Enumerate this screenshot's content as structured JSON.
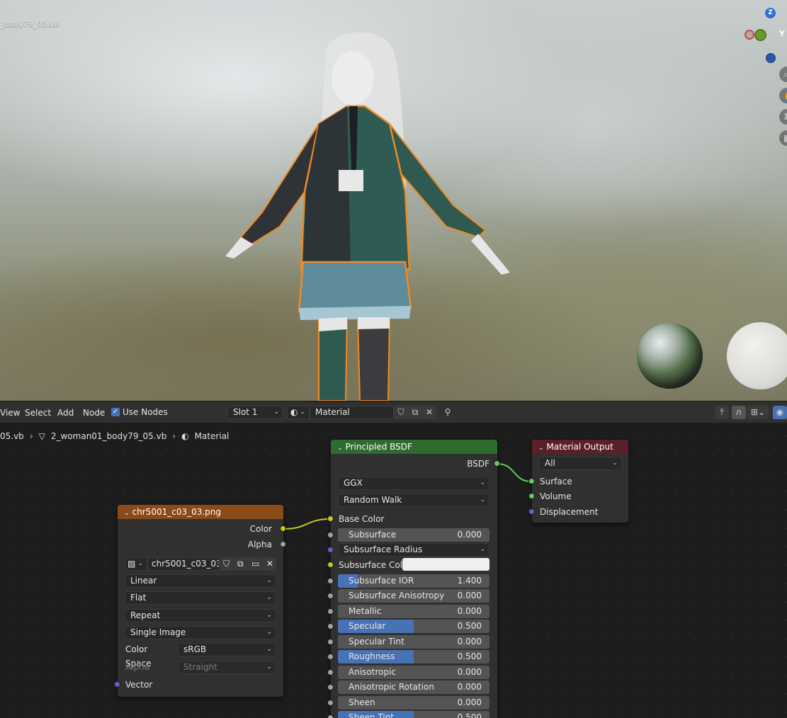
{
  "viewport": {
    "file_label": "_body79_05.vb",
    "gizmo": {
      "z": "Z",
      "y": "Y"
    }
  },
  "node_header": {
    "menus": [
      "View",
      "Select",
      "Add",
      "Node"
    ],
    "use_nodes_label": "Use Nodes",
    "use_nodes_checked": true,
    "slot": "Slot 1",
    "material_name": "Material"
  },
  "breadcrumb": {
    "object": "05.vb",
    "mesh": "2_woman01_body79_05.vb",
    "material": "Material"
  },
  "image_node": {
    "title": "chr5001_c03_03.png",
    "title_color": "#8b4a17",
    "outputs": {
      "color": "Color",
      "alpha": "Alpha"
    },
    "image_name": "chr5001_c03_03.p...",
    "interpolation": "Linear",
    "projection": "Flat",
    "extension": "Repeat",
    "source": "Single Image",
    "color_space_label": "Color Space",
    "color_space": "sRGB",
    "alpha_label": "Alpha",
    "alpha_mode": "Straight",
    "vector_label": "Vector"
  },
  "bsdf_node": {
    "title": "Principled BSDF",
    "title_color": "#2e6b2e",
    "output_label": "BSDF",
    "distribution": "GGX",
    "subsurface_method": "Random Walk",
    "base_color_label": "Base Color",
    "subsurface_radius_label": "Subsurface Radius",
    "subsurface_color_label": "Subsurface Color",
    "sliders": [
      {
        "label": "Subsurface",
        "value": "0.000",
        "fraction": 0.0
      },
      {
        "label": "Subsurface IOR",
        "value": "1.400",
        "fraction": 0.13
      },
      {
        "label": "Subsurface Anisotropy",
        "value": "0.000",
        "fraction": 0.0
      },
      {
        "label": "Metallic",
        "value": "0.000",
        "fraction": 0.0
      },
      {
        "label": "Specular",
        "value": "0.500",
        "fraction": 0.5
      },
      {
        "label": "Specular Tint",
        "value": "0.000",
        "fraction": 0.0
      },
      {
        "label": "Roughness",
        "value": "0.500",
        "fraction": 0.5
      },
      {
        "label": "Anisotropic",
        "value": "0.000",
        "fraction": 0.0
      },
      {
        "label": "Anisotropic Rotation",
        "value": "0.000",
        "fraction": 0.0
      },
      {
        "label": "Sheen",
        "value": "0.000",
        "fraction": 0.0
      },
      {
        "label": "Sheen Tint",
        "value": "0.500",
        "fraction": 0.5
      }
    ]
  },
  "output_node": {
    "title": "Material Output",
    "title_color": "#5a1f2b",
    "target": "All",
    "inputs": {
      "surface": "Surface",
      "volume": "Volume",
      "displacement": "Displacement"
    }
  }
}
